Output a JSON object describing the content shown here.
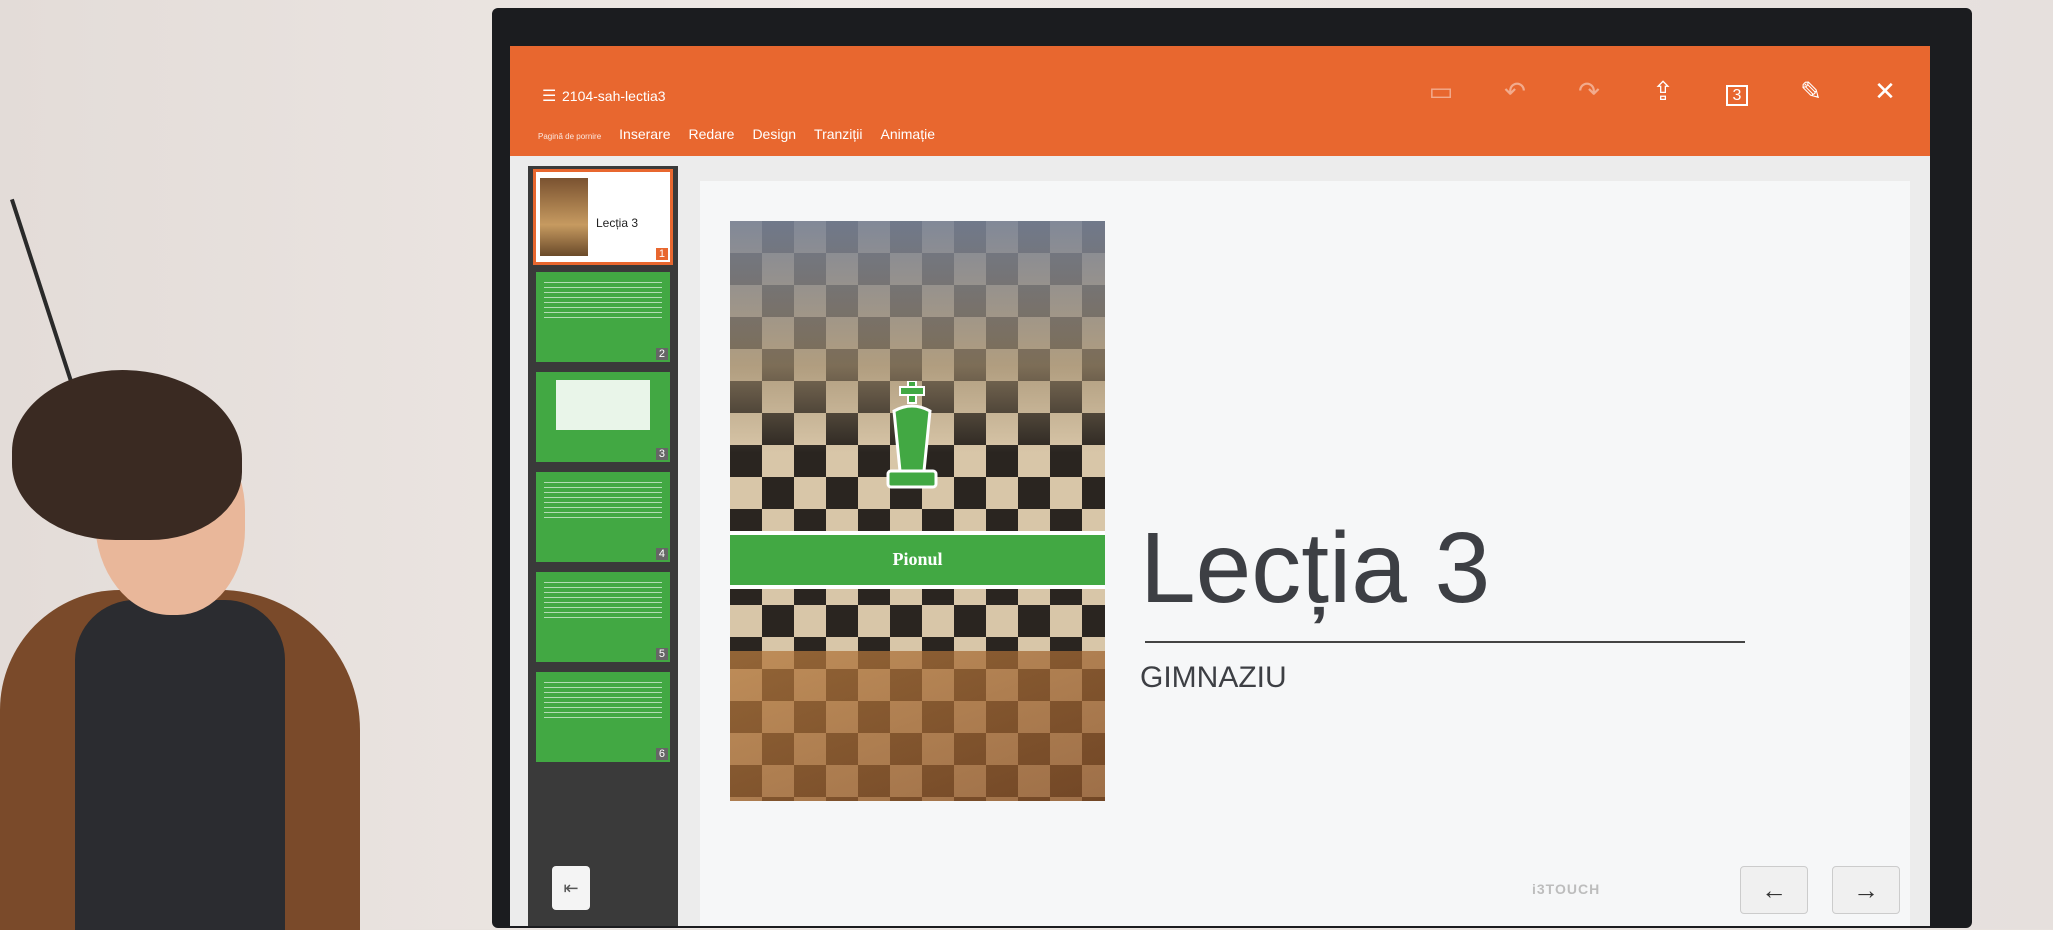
{
  "app": {
    "doc_title": "2104-sah-lectia3"
  },
  "toolbar": {
    "tabs": [
      {
        "label": "Pagină de pornire"
      },
      {
        "label": "Inserare"
      },
      {
        "label": "Redare"
      },
      {
        "label": "Design"
      },
      {
        "label": "Tranziții"
      },
      {
        "label": "Animație"
      }
    ],
    "page_indicator": "3",
    "colors": {
      "accent": "#e8672f",
      "slide_green": "#42a843"
    }
  },
  "thumbnails": [
    {
      "num": "1",
      "label": "Lecția 3"
    },
    {
      "num": "2"
    },
    {
      "num": "3"
    },
    {
      "num": "4"
    },
    {
      "num": "5"
    },
    {
      "num": "6"
    }
  ],
  "slide": {
    "title": "Lecția 3",
    "subtitle": "GIMNAZIU",
    "image_caption": "Pionul"
  },
  "monitor": {
    "brand": "i3TOUCH"
  },
  "nav": {
    "prev": "←",
    "next": "→"
  }
}
